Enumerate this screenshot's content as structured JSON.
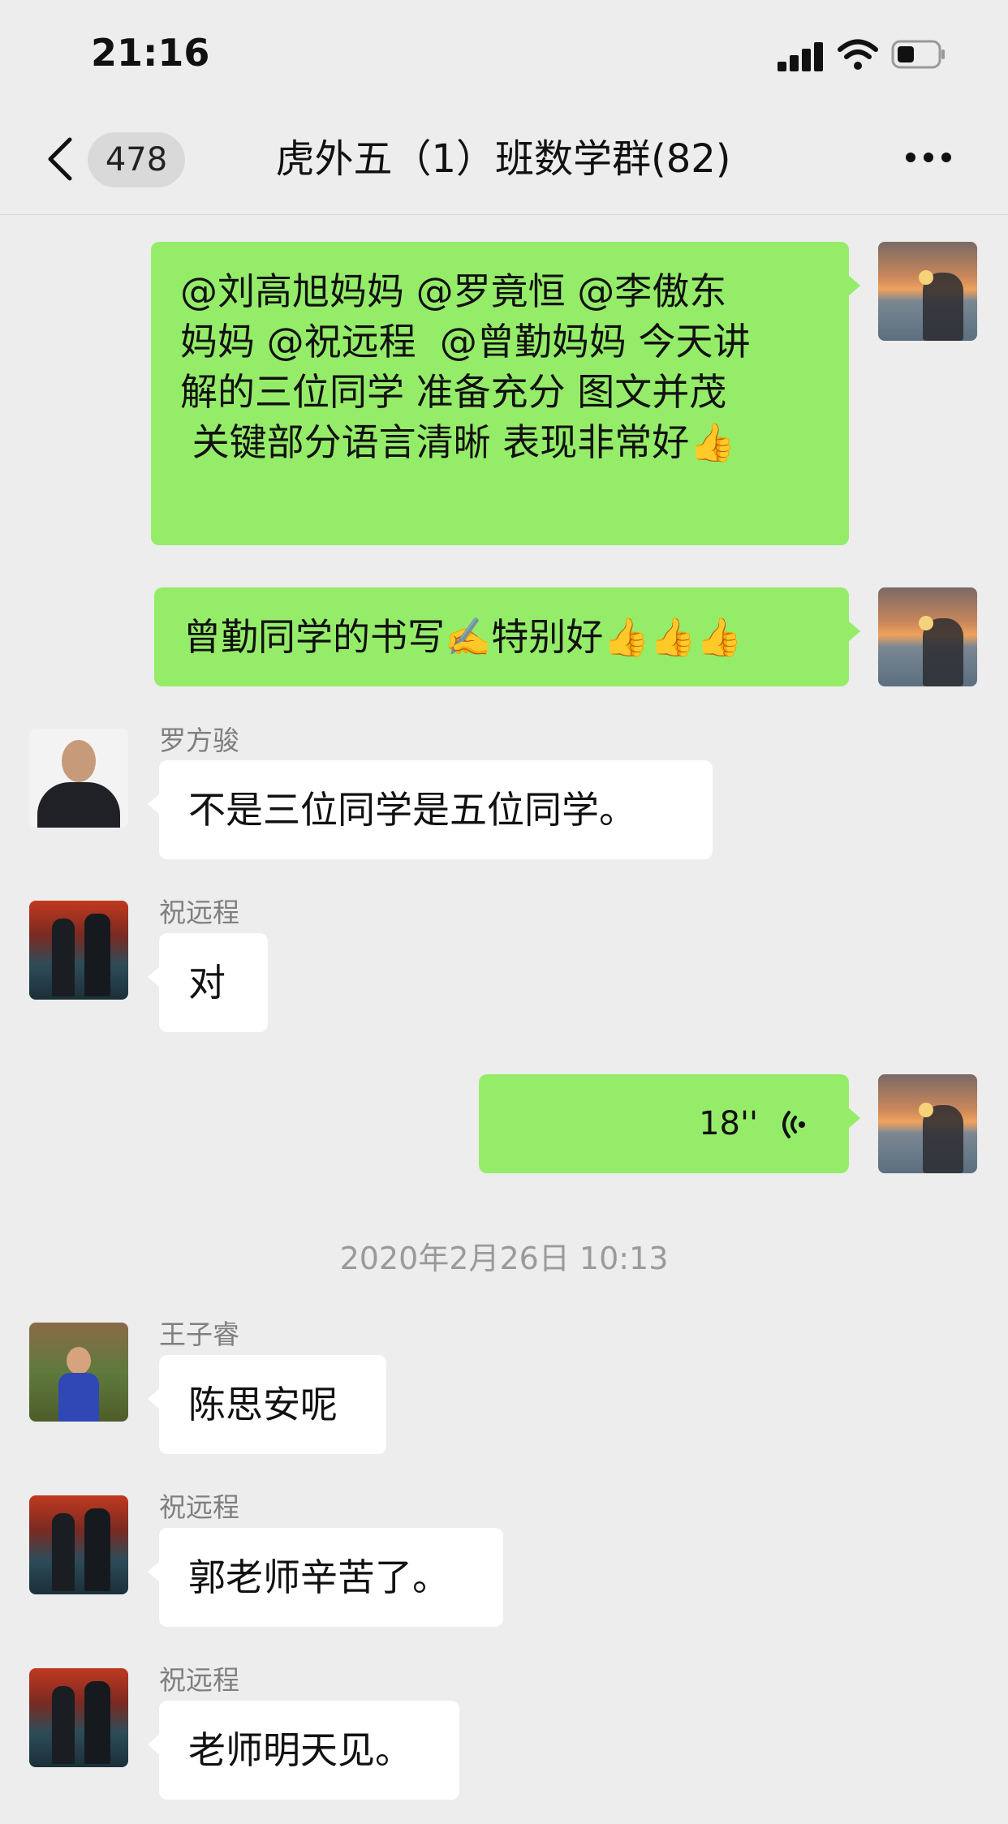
{
  "status_bar": {
    "time": "21:16"
  },
  "nav": {
    "unread_count": "478",
    "title": "虎外五（1）班数学群(82)"
  },
  "messages": [
    {
      "side": "right",
      "text": "@刘高旭妈妈 @罗竟恒 @李傲东妈妈 @祝远程  @曾勤妈妈 今天讲解的三位同学 准备充分 图文并茂 关键部分语言清晰 表现非常好👍",
      "lines": [
        "@刘高旭妈妈 @罗竟恒 @李傲东",
        "妈妈 @祝远程  @曾勤妈妈 今天讲",
        "解的三位同学 准备充分 图文并茂",
        " 关键部分语言清晰 表现非常好👍"
      ]
    },
    {
      "side": "right",
      "text": "曾勤同学的书写✍️特别好👍👍👍"
    },
    {
      "side": "left",
      "sender": "罗方骏",
      "text": "不是三位同学是五位同学。"
    },
    {
      "side": "left",
      "sender": "祝远程",
      "text": "对"
    },
    {
      "side": "right",
      "type": "voice",
      "duration": "18''"
    },
    {
      "type": "time",
      "text": "2020年2月26日 10:13"
    },
    {
      "side": "left",
      "sender": "王子睿",
      "text": "陈思安呢"
    },
    {
      "side": "left",
      "sender": "祝远程",
      "text": "郭老师辛苦了。"
    },
    {
      "side": "left",
      "sender": "祝远程",
      "text": "老师明天见。"
    }
  ],
  "icons": {
    "signal": "cellular-signal-icon",
    "wifi": "wifi-icon",
    "battery": "battery-icon",
    "back": "chevron-left-icon",
    "more": "more-dots-icon",
    "voice": "voice-wave-icon"
  },
  "colors": {
    "background": "#ededed",
    "bubble_self": "#95ec69",
    "bubble_other": "#ffffff"
  }
}
